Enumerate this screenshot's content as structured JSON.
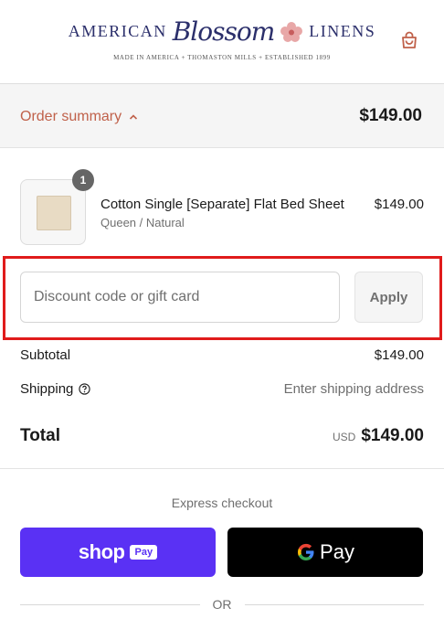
{
  "brand": {
    "word_left": "AMERICAN",
    "word_script": "Blossom",
    "word_right": "LINENS",
    "tagline": "MADE IN AMERICA + THOMASTON MILLS + ESTABLISHED 1899",
    "color": "#2b2f6b"
  },
  "header": {
    "cart_icon": "shopping-bag-icon"
  },
  "summary": {
    "toggle_label": "Order summary",
    "toggle_icon": "chevron-up-icon",
    "total": "$149.00",
    "accent": "#c0614a"
  },
  "cart": {
    "items": [
      {
        "quantity": "1",
        "name": "Cotton Single [Separate] Flat Bed Sheet",
        "variant": "Queen / Natural",
        "price": "$149.00"
      }
    ]
  },
  "discount": {
    "placeholder": "Discount code or gift card",
    "value": "",
    "apply_label": "Apply"
  },
  "totals": {
    "subtotal_label": "Subtotal",
    "subtotal_value": "$149.00",
    "shipping_label": "Shipping",
    "shipping_value": "Enter shipping address",
    "total_label": "Total",
    "currency": "USD",
    "total_value": "$149.00"
  },
  "express": {
    "title": "Express checkout",
    "shop_pay": {
      "word": "shop",
      "chip": "Pay",
      "color": "#5a31f4"
    },
    "google_pay": {
      "word": "Pay",
      "color": "#000000"
    },
    "or_label": "OR"
  }
}
